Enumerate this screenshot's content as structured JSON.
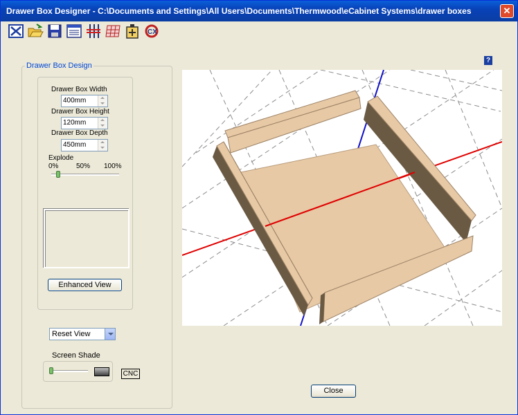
{
  "window": {
    "title": "Drawer Box Designer - C:\\Documents and Settings\\All Users\\Documents\\Thermwood\\eCabinet Systems\\drawer boxes",
    "close_glyph": "✕"
  },
  "toolbar": {
    "icons": [
      "exit-icon",
      "open-folder-icon",
      "save-disk-icon",
      "window-view-icon",
      "cut-lines-icon",
      "grid-icon",
      "battery-icon",
      "cnc-logo-icon"
    ]
  },
  "design": {
    "legend": "Drawer Box Design",
    "width_label": "Drawer Box Width",
    "width_value": "400mm",
    "height_label": "Drawer Box Height",
    "height_value": "120mm",
    "depth_label": "Drawer Box Depth",
    "depth_value": "450mm",
    "explode_label": "Explode",
    "explode_ticks": [
      "0%",
      "50%",
      "100%"
    ],
    "explode_value_pct": 10,
    "enhanced_view_label": "Enhanced View"
  },
  "view": {
    "reset_view": "Reset View",
    "screen_shade_label": "Screen Shade",
    "screen_shade_value_pct": 5,
    "cnc_label": "CNC"
  },
  "help_glyph": "?",
  "close_label": "Close",
  "colors": {
    "wood_top": "#e7c9a5",
    "wood_side": "#6a5a43",
    "x_axis": "#e00000",
    "y_axis": "#1010c8",
    "grid": "#8c8c8c"
  }
}
